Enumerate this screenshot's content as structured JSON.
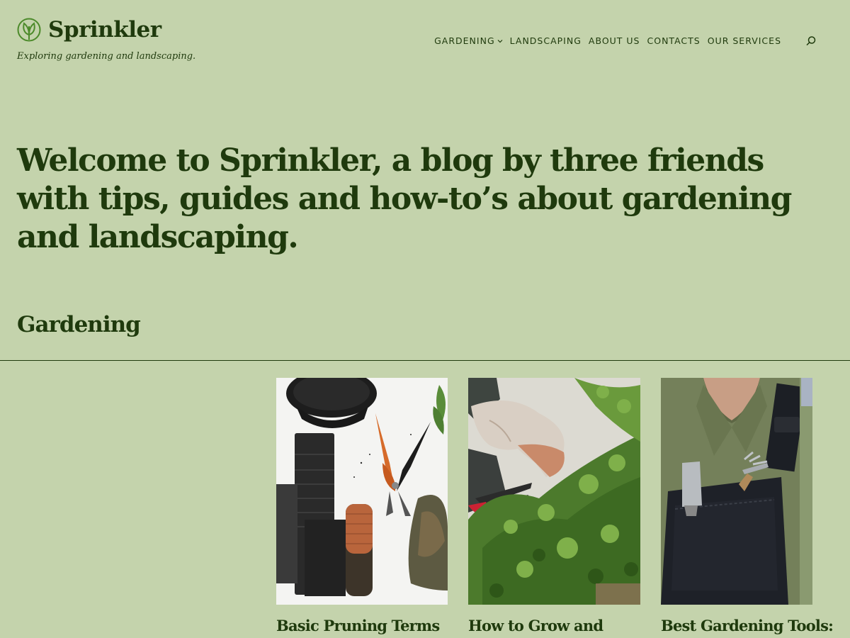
{
  "site": {
    "title": "Sprinkler",
    "tagline": "Exploring gardening and landscaping."
  },
  "nav": {
    "items": [
      {
        "label": "GARDENING",
        "has_dropdown": true
      },
      {
        "label": "LANDSCAPING"
      },
      {
        "label": "ABOUT US"
      },
      {
        "label": "CONTACTS"
      },
      {
        "label": "OUR SERVICES"
      }
    ],
    "search_icon": "search-icon"
  },
  "hero": {
    "heading": "Welcome to Sprinkler, a blog by three friends with tips, guides and how-to’s about gardening and landscaping."
  },
  "section": {
    "title": "Gardening"
  },
  "posts": [
    {
      "title": "Basic Pruning Terms",
      "image": "pots-and-pruners-photo"
    },
    {
      "title": "How to Grow and",
      "image": "gloved-hands-pruning-shrub-photo"
    },
    {
      "title": "Best Gardening Tools:",
      "image": "tools-in-overalls-pocket-photo"
    }
  ],
  "colors": {
    "background": "#c4d3ac",
    "text": "#1f3a0d",
    "logo": "#4c8a2a"
  }
}
